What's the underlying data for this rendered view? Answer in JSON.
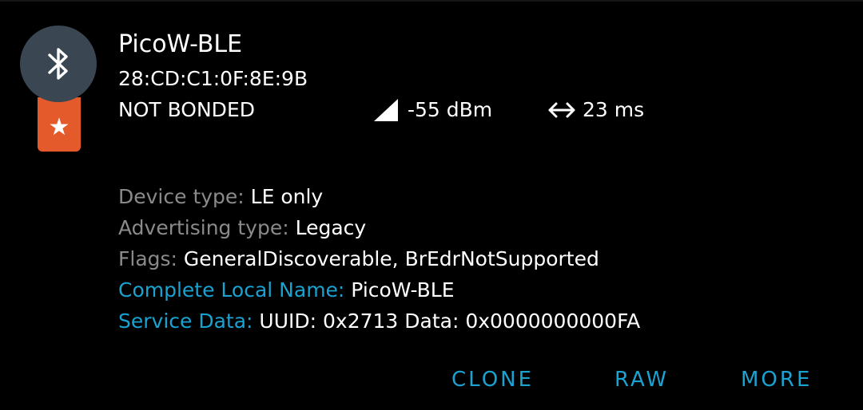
{
  "device": {
    "name": "PicoW-BLE",
    "mac": "28:CD:C1:0F:8E:9B",
    "bond_state": "NOT BONDED",
    "rssi": "-55 dBm",
    "interval": "23 ms",
    "icon": "bluetooth-icon",
    "badge_icon": "star-icon",
    "badge_color": "#e55a2b",
    "avatar_color": "#3a4752"
  },
  "details": {
    "device_type": {
      "label": "Device type: ",
      "value": "LE only"
    },
    "advertising_type": {
      "label": "Advertising type: ",
      "value": "Legacy"
    },
    "flags": {
      "label": "Flags: ",
      "value": "GeneralDiscoverable, BrEdrNotSupported"
    },
    "local_name": {
      "label": "Complete Local Name: ",
      "value": "PicoW-BLE"
    },
    "service_data": {
      "label": "Service Data: ",
      "value": "UUID: 0x2713 Data: 0x0000000000FA"
    }
  },
  "actions": {
    "clone": "CLONE",
    "raw": "RAW",
    "more": "MORE"
  },
  "colors": {
    "accent": "#1aa2d1",
    "label_gray": "#8a8a8a",
    "background": "#000000"
  }
}
